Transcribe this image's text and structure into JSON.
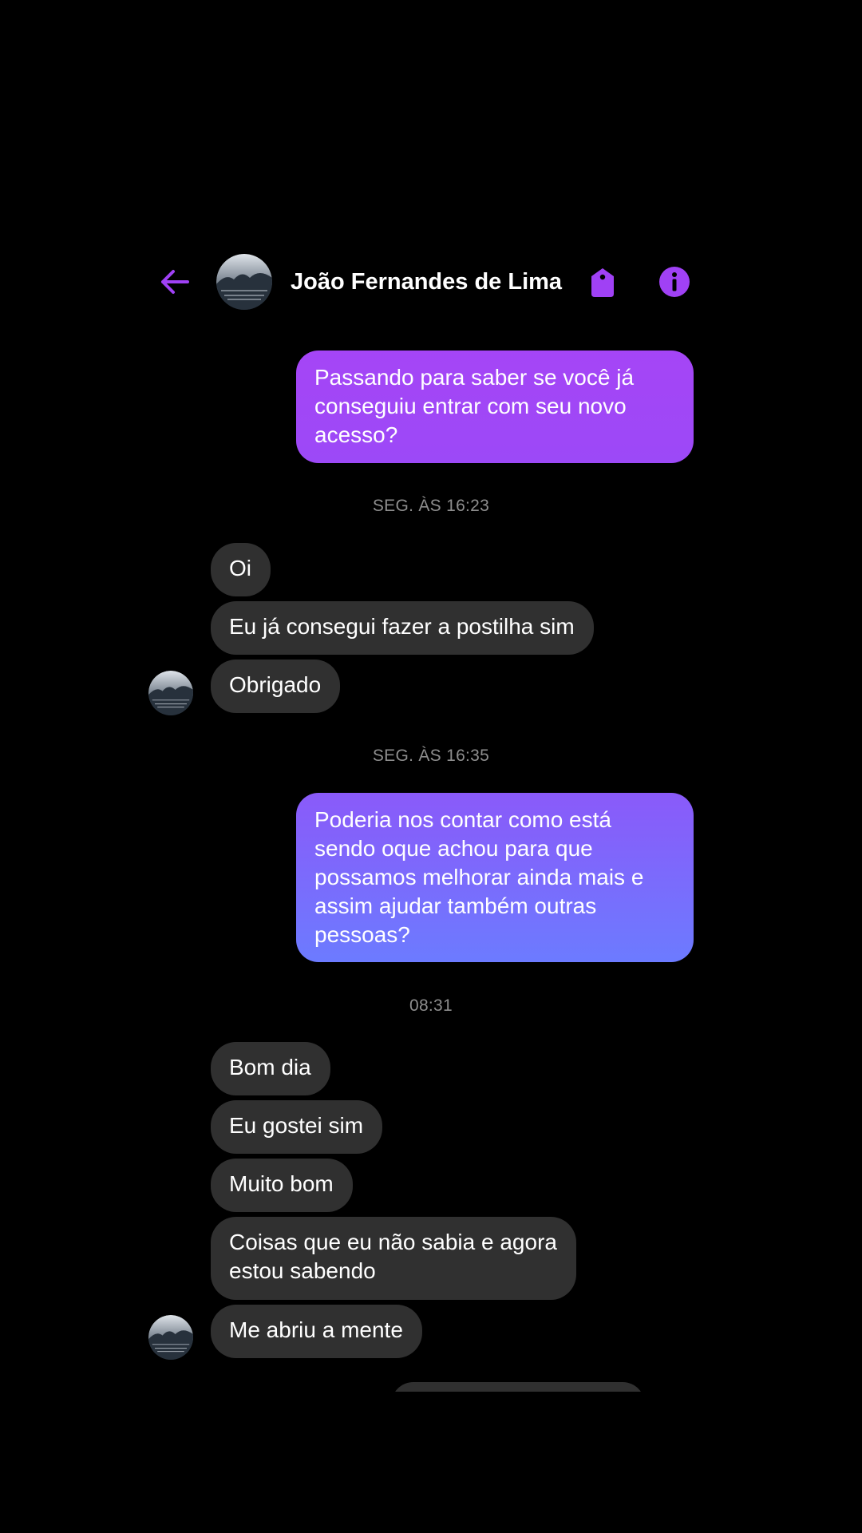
{
  "header": {
    "contact_name": "João Fernandes de Lima",
    "back_icon": "arrow-left-icon",
    "tag_icon": "tag-icon",
    "info_icon": "info-circle-icon"
  },
  "colors": {
    "accent": "#a041f5",
    "outgoing_top": "#a545f6",
    "outgoing_mid": "#8f55f9",
    "outgoing_bottom": "#6a7dff",
    "incoming_bubble": "#303030",
    "timestamp": "#8e8e8e",
    "background": "#000000"
  },
  "conversation": {
    "sent_1": "Passando para saber se você já conseguiu entrar com seu novo acesso?",
    "time_1": "SEG. ÀS 16:23",
    "received_1": "Oi",
    "received_2": "Eu já consegui fazer a postilha sim",
    "received_3": "Obrigado",
    "time_2": "SEG. ÀS 16:35",
    "sent_2": "Poderia nos contar como está sendo oque achou para que possamos melhorar ainda mais e assim ajudar também outras pessoas?",
    "time_3": "08:31",
    "received_4": "Bom dia",
    "received_5": "Eu gostei sim",
    "received_6": "Muito bom",
    "received_7": "Coisas que eu não sabia e agora\nestou sabendo",
    "received_8": "Me abriu a mente"
  }
}
